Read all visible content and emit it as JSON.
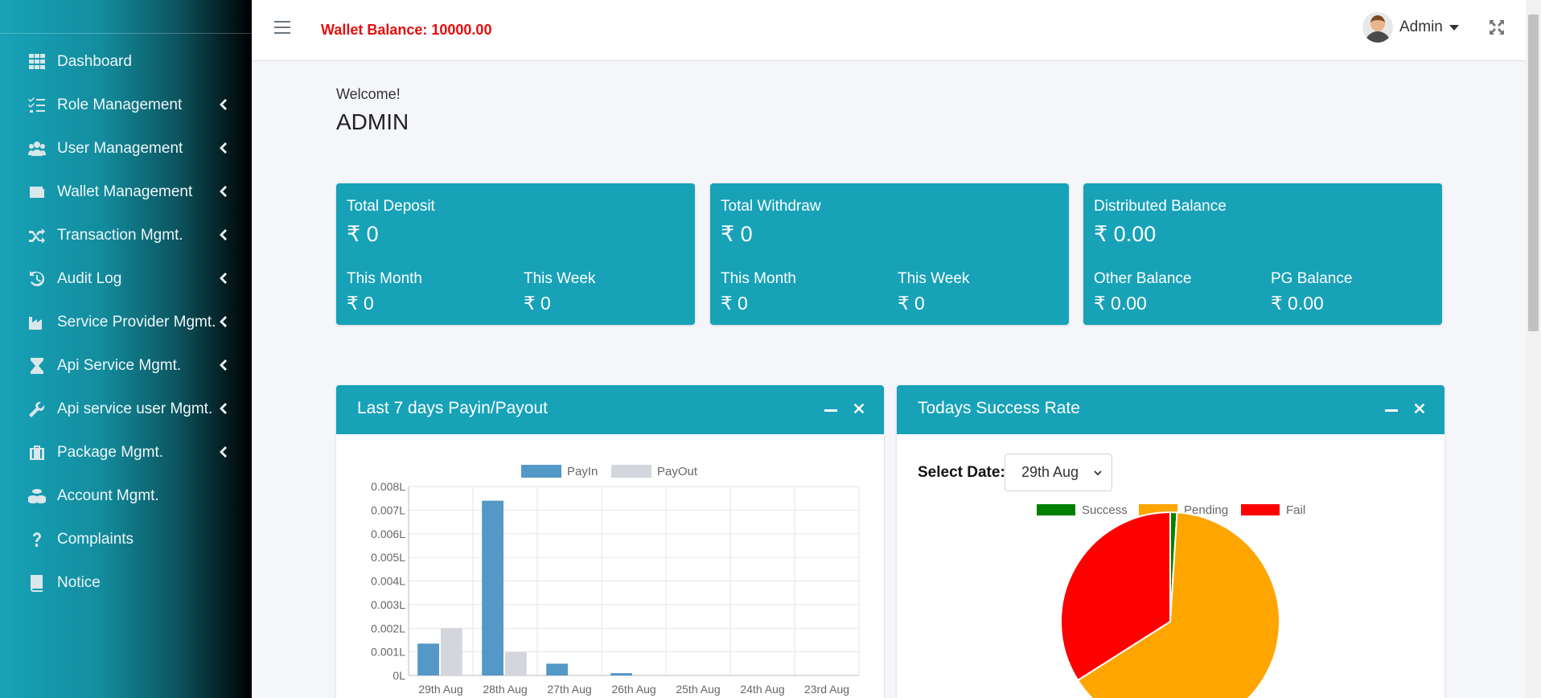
{
  "sidebar": {
    "items": [
      {
        "label": "Dashboard",
        "icon": "grid-icon",
        "chevron": false
      },
      {
        "label": "Role Management",
        "icon": "list-check-icon",
        "chevron": true
      },
      {
        "label": "User Management",
        "icon": "users-icon",
        "chevron": true
      },
      {
        "label": "Wallet Management",
        "icon": "wallet-icon",
        "chevron": true
      },
      {
        "label": "Transaction Mgmt.",
        "icon": "shuffle-icon",
        "chevron": true
      },
      {
        "label": "Audit Log",
        "icon": "history-icon",
        "chevron": true
      },
      {
        "label": "Service Provider Mgmt.",
        "icon": "industry-icon",
        "chevron": true
      },
      {
        "label": "Api Service Mgmt.",
        "icon": "hourglass-icon",
        "chevron": true
      },
      {
        "label": "Api service user Mgmt.",
        "icon": "wrench-icon",
        "chevron": true
      },
      {
        "label": "Package Mgmt.",
        "icon": "suitcase-icon",
        "chevron": true
      },
      {
        "label": "Account Mgmt.",
        "icon": "coins-icon",
        "chevron": false
      },
      {
        "label": "Complaints",
        "icon": "question-icon",
        "chevron": false
      },
      {
        "label": "Notice",
        "icon": "book-icon",
        "chevron": false
      }
    ]
  },
  "header": {
    "wallet_balance": "Wallet Balance: 10000.00",
    "user_name": "Admin"
  },
  "welcome": {
    "greeting": "Welcome!",
    "name": "ADMIN"
  },
  "cards": [
    {
      "title": "Total Deposit",
      "value": "₹ 0",
      "left_label": "This Month",
      "left_value": "₹ 0",
      "right_label": "This Week",
      "right_value": "₹ 0"
    },
    {
      "title": "Total Withdraw",
      "value": "₹ 0",
      "left_label": "This Month",
      "left_value": "₹ 0",
      "right_label": "This Week",
      "right_value": "₹ 0"
    },
    {
      "title": "Distributed Balance",
      "value": "₹ 0.00",
      "left_label": "Other Balance",
      "left_value": "₹ 0.00",
      "right_label": "PG Balance",
      "right_value": "₹ 0.00"
    }
  ],
  "panels": {
    "bar": {
      "title": "Last 7 days Payin/Payout"
    },
    "pie": {
      "title": "Todays Success Rate",
      "select_label": "Select Date:",
      "selected_date": "29th Aug"
    }
  },
  "colors": {
    "accent": "#17a2b8",
    "payin": "#5498c8",
    "payout": "#d4d6dd",
    "success": "#008000",
    "pending": "#ffa500",
    "fail": "#ff0000",
    "wallet_text": "#e30d0d"
  },
  "chart_data": [
    {
      "type": "bar",
      "categories": [
        "29th Aug",
        "28th Aug",
        "27th Aug",
        "26th Aug",
        "25th Aug",
        "24th Aug",
        "23rd Aug"
      ],
      "series": [
        {
          "name": "PayIn",
          "values": [
            0.00135,
            0.0074,
            0.0005,
            0.0001,
            0,
            0,
            0
          ]
        },
        {
          "name": "PayOut",
          "values": [
            0.002,
            0.001,
            0,
            0,
            0,
            0,
            0
          ]
        }
      ],
      "ylim": [
        0,
        0.008
      ],
      "yticks": [
        "0L",
        "0.001L",
        "0.002L",
        "0.003L",
        "0.004L",
        "0.005L",
        "0.006L",
        "0.007L",
        "0.008L"
      ],
      "legend": "top",
      "grid": true
    },
    {
      "type": "pie",
      "labels": [
        "Success",
        "Pending",
        "Fail"
      ],
      "values": [
        1,
        65,
        34
      ],
      "legend": "top"
    }
  ]
}
